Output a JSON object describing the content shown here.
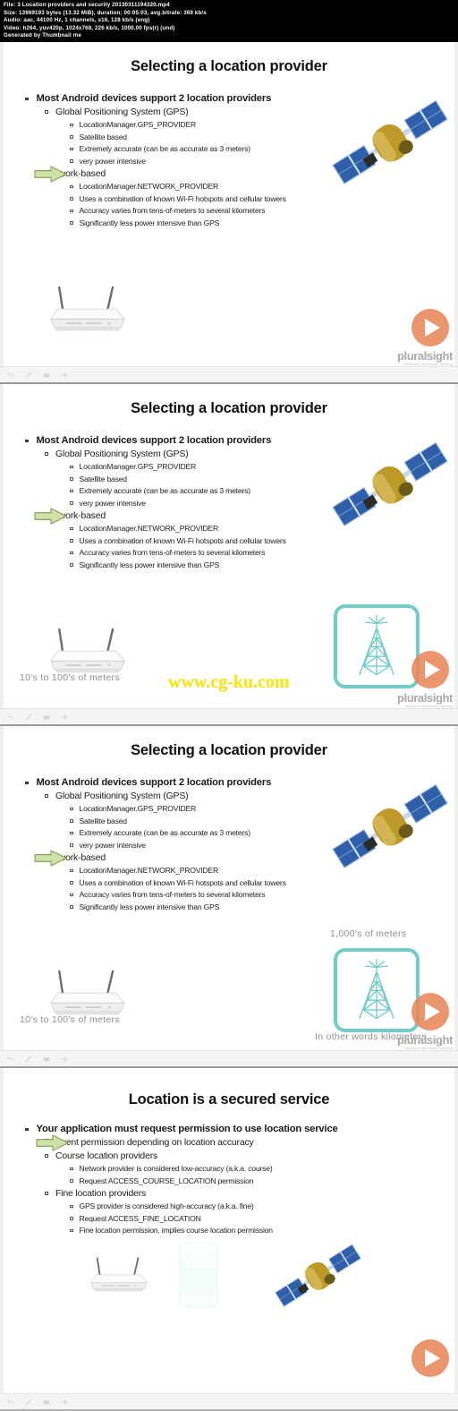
{
  "meta": {
    "file_line": "File: 3 Location providers and security 20130311194320.mp4",
    "size_line": "Size: 13969193 bytes (13.32 MiB), duration: 00:05:03, avg.bitrate: 369 kb/s",
    "audio_line": "Audio: aac, 44100 Hz, 1 channels, s16, 128 kb/s (eng)",
    "video_line": "Video: h264, yuv420p, 1024x768, 226 kb/s, 1000.00 fps(r) (und)",
    "generated_line": "Generated by Thumbnail me"
  },
  "brand": {
    "logo_text": "pluralsight",
    "logo_subtext": "hardcore developer training",
    "play_icon": "play-icon",
    "accent_color": "#e8875a",
    "tower_color": "#72ccc9"
  },
  "watermark": {
    "text": "www.cg-ku.com",
    "color": "#fbe713"
  },
  "frames": [
    {
      "title": "Selecting a location provider",
      "bullets": [
        {
          "level": 1,
          "marker": "square",
          "text": "Most Android devices support 2 location providers"
        },
        {
          "level": 2,
          "marker": "hollow",
          "text": "Global Positioning System (GPS)"
        },
        {
          "level": 3,
          "marker": "hollow-small",
          "text": "LocationManager.GPS_PROVIDER"
        },
        {
          "level": 3,
          "marker": "hollow-small",
          "text": "Satellite based"
        },
        {
          "level": 3,
          "marker": "hollow-small",
          "text": "Extremely accurate (can be as accurate as 3 meters)"
        },
        {
          "level": 3,
          "marker": "hollow-small",
          "text": "very power intensive"
        },
        {
          "level": 2,
          "marker": "none",
          "text": "Network-based"
        },
        {
          "level": 3,
          "marker": "hollow-small",
          "text": "LocationManager.NETWORK_PROVIDER"
        },
        {
          "level": 3,
          "marker": "hollow-small",
          "text": "Uses a combination of known Wi-Fi hotspots and cellular towers"
        },
        {
          "level": 3,
          "marker": "hollow-small",
          "text": "Accuracy varies from tens-of-meters to several kilometers"
        },
        {
          "level": 3,
          "marker": "hollow-small",
          "text": "Significantly less power intensive than GPS"
        }
      ],
      "annotations": [],
      "has_arrow": true,
      "has_satellite": true,
      "has_router": true,
      "has_tower": false,
      "has_watermark": false
    },
    {
      "title": "Selecting a location provider",
      "bullets": [
        {
          "level": 1,
          "marker": "square",
          "text": "Most Android devices support 2 location providers"
        },
        {
          "level": 2,
          "marker": "hollow",
          "text": "Global Positioning System (GPS)"
        },
        {
          "level": 3,
          "marker": "hollow-small",
          "text": "LocationManager.GPS_PROVIDER"
        },
        {
          "level": 3,
          "marker": "hollow-small",
          "text": "Satellite based"
        },
        {
          "level": 3,
          "marker": "hollow-small",
          "text": "Extremely accurate (can be as accurate as 3 meters)"
        },
        {
          "level": 3,
          "marker": "hollow-small",
          "text": "very power intensive"
        },
        {
          "level": 2,
          "marker": "none",
          "text": "Network-based"
        },
        {
          "level": 3,
          "marker": "hollow-small",
          "text": "LocationManager.NETWORK_PROVIDER"
        },
        {
          "level": 3,
          "marker": "hollow-small",
          "text": "Uses a combination of known Wi-Fi hotspots and cellular towers"
        },
        {
          "level": 3,
          "marker": "hollow-small",
          "text": "Accuracy varies from tens-of-meters to several kilometers"
        },
        {
          "level": 3,
          "marker": "hollow-small",
          "text": "Significantly less power intensive than GPS"
        }
      ],
      "annotations": [
        {
          "name": "meters-range-label",
          "text": "10's to 100's of meters"
        }
      ],
      "has_arrow": true,
      "has_satellite": true,
      "has_router": true,
      "has_tower": true,
      "has_watermark": true
    },
    {
      "title": "Selecting a location provider",
      "bullets": [
        {
          "level": 1,
          "marker": "square",
          "text": "Most Android devices support 2 location providers"
        },
        {
          "level": 2,
          "marker": "hollow",
          "text": "Global Positioning System (GPS)"
        },
        {
          "level": 3,
          "marker": "hollow-small",
          "text": "LocationManager.GPS_PROVIDER"
        },
        {
          "level": 3,
          "marker": "hollow-small",
          "text": "Satellite based"
        },
        {
          "level": 3,
          "marker": "hollow-small",
          "text": "Extremely accurate (can be as accurate as 3 meters)"
        },
        {
          "level": 3,
          "marker": "hollow-small",
          "text": "very power intensive"
        },
        {
          "level": 2,
          "marker": "none",
          "text": "Network-based"
        },
        {
          "level": 3,
          "marker": "hollow-small",
          "text": "LocationManager.NETWORK_PROVIDER"
        },
        {
          "level": 3,
          "marker": "hollow-small",
          "text": "Uses a combination of known Wi-Fi hotspots and cellular towers"
        },
        {
          "level": 3,
          "marker": "hollow-small",
          "text": "Accuracy varies from tens-of-meters to several kilometers"
        },
        {
          "level": 3,
          "marker": "hollow-small",
          "text": "Significantly less power intensive than GPS"
        }
      ],
      "annotations": [
        {
          "name": "meters-range-label",
          "text": "10's to 100's of meters"
        },
        {
          "name": "kilometers-range-label",
          "text": "1,000's of meters"
        },
        {
          "name": "kilometers-note-label",
          "text": "In other words kilometers"
        }
      ],
      "has_arrow": true,
      "has_satellite": true,
      "has_router": true,
      "has_tower": true,
      "has_watermark": false
    },
    {
      "title": "Location is a secured service",
      "bullets": [
        {
          "level": 1,
          "marker": "square",
          "text": "Your application must request permission to use location service"
        },
        {
          "level": 2,
          "marker": "none",
          "text": "Different permission depending on location accuracy"
        },
        {
          "level": 2,
          "marker": "hollow",
          "text": "Course location providers"
        },
        {
          "level": 3,
          "marker": "hollow-small",
          "text": "Network provider is considered low-accuracy (a.k.a. course)"
        },
        {
          "level": 3,
          "marker": "hollow-small",
          "text": "Request ACCESS_COURSE_LOCATION permission"
        },
        {
          "level": 2,
          "marker": "hollow",
          "text": "Fine location providers"
        },
        {
          "level": 3,
          "marker": "hollow-small",
          "text": "GPS provider is considered high-accuracy (a.k.a. fine)"
        },
        {
          "level": 3,
          "marker": "hollow-small",
          "text": "Request ACCESS_FINE_LOCATION"
        },
        {
          "level": 3,
          "marker": "hollow-small",
          "text": "Fine location permission, implies course location permission"
        }
      ],
      "annotations": [],
      "has_arrow": true,
      "has_satellite": true,
      "has_router": true,
      "has_tower": false,
      "has_watermark": false
    }
  ],
  "toolbar": {
    "icons": [
      "undo-icon",
      "pen-icon",
      "slide-icon",
      "next-icon"
    ]
  }
}
